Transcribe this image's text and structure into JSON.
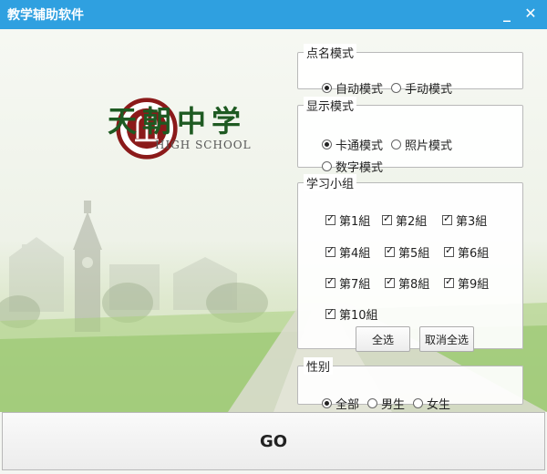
{
  "window": {
    "title": "教学辅助软件",
    "minimize_glyph": "_",
    "close_glyph": "✕"
  },
  "logo": {
    "name_cn": "天朝中学",
    "name_en": "HIGH SCHOOL",
    "emblem_text": "HIGH SCHOOL",
    "brand_color": "#1e5a22",
    "emblem_color": "#8b1a1a"
  },
  "call_mode": {
    "legend": "点名模式",
    "options": [
      {
        "label": "自动模式",
        "checked": true
      },
      {
        "label": "手动模式",
        "checked": false
      }
    ]
  },
  "display_mode": {
    "legend": "显示模式",
    "options": [
      {
        "label": "卡通模式",
        "checked": true
      },
      {
        "label": "照片模式",
        "checked": false
      },
      {
        "label": "数字模式",
        "checked": false
      }
    ]
  },
  "groups": {
    "legend": "学习小组",
    "items": [
      {
        "label": "第1組",
        "checked": true
      },
      {
        "label": "第2組",
        "checked": true
      },
      {
        "label": "第3組",
        "checked": true
      },
      {
        "label": "第4組",
        "checked": true
      },
      {
        "label": "第5組",
        "checked": true
      },
      {
        "label": "第6組",
        "checked": true
      },
      {
        "label": "第7組",
        "checked": true
      },
      {
        "label": "第8組",
        "checked": true
      },
      {
        "label": "第9組",
        "checked": true
      },
      {
        "label": "第10組",
        "checked": true
      }
    ],
    "select_all": "全选",
    "deselect_all": "取消全选"
  },
  "gender": {
    "legend": "性别",
    "options": [
      {
        "label": "全部",
        "checked": true
      },
      {
        "label": "男生",
        "checked": false
      },
      {
        "label": "女生",
        "checked": false
      }
    ]
  },
  "go_button": "GO",
  "colors": {
    "titlebar": "#2fa0e0"
  }
}
